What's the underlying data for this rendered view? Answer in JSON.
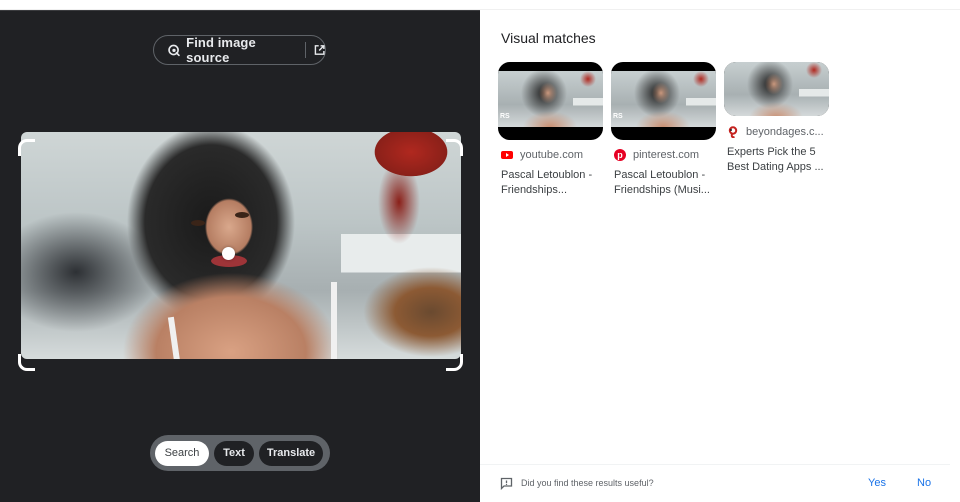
{
  "header": {
    "find_image_source_label": "Find image source",
    "lens_icon": "google-lens-icon",
    "open_external_icon": "open-in-new-icon"
  },
  "selection": {
    "image_alt": "Photo of a woman with dark hair sitting on a bed",
    "focus_point_icon": "focus-dot"
  },
  "modes": {
    "items": [
      {
        "label": "Search",
        "active": true
      },
      {
        "label": "Text",
        "active": false
      },
      {
        "label": "Translate",
        "active": false
      }
    ]
  },
  "results": {
    "title": "Visual matches",
    "cards": [
      {
        "source": "youtube.com",
        "source_icon": "youtube-icon",
        "title": "Pascal Letoublon - Friendships...",
        "watermark": "RS"
      },
      {
        "source": "pinterest.com",
        "source_icon": "pinterest-icon",
        "title": "Pascal Letoublon - Friendships (Musi...",
        "watermark": "RS"
      },
      {
        "source": "beyondages.c...",
        "source_icon": "beyondages-icon",
        "title": "Experts Pick the 5 Best Dating Apps ..."
      }
    ]
  },
  "feedback": {
    "question": "Did you find these results useful?",
    "yes_label": "Yes",
    "no_label": "No",
    "icon": "feedback-icon"
  },
  "colors": {
    "dark_panel": "#202124",
    "link_blue": "#1a73e8",
    "youtube_red": "#ff0000",
    "pinterest_red": "#e60023"
  }
}
